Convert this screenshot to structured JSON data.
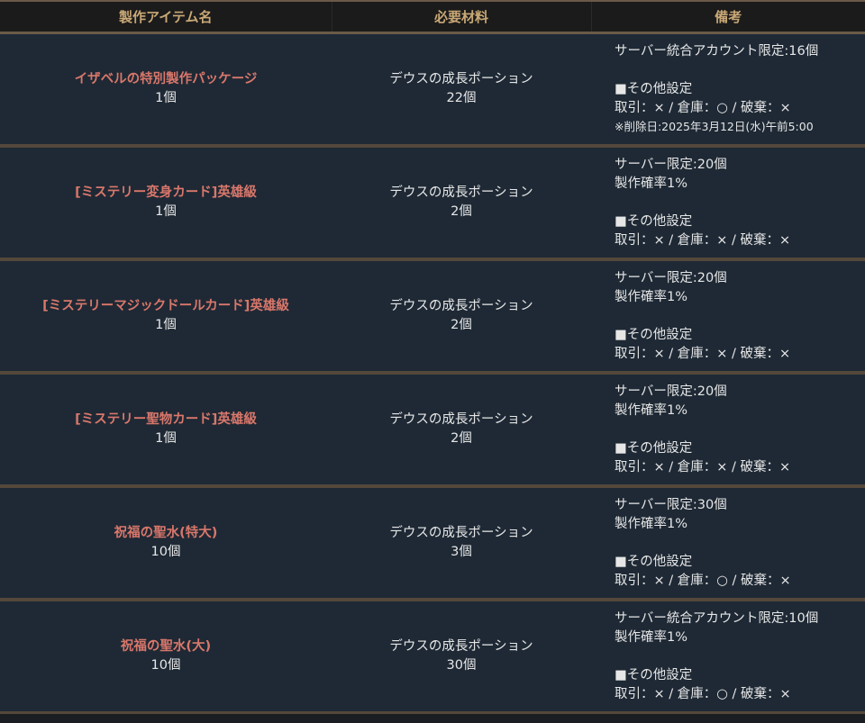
{
  "headers": {
    "item": "製作アイテム名",
    "materials": "必要材料",
    "notes": "備考"
  },
  "rows": [
    {
      "item_name": "イザベルの特別製作パッケージ",
      "item_qty": "1個",
      "material_name": "デウスの成長ポーション",
      "material_qty": "22個",
      "notes": [
        "サーバー統合アカウント限定:16個",
        "",
        "■その他設定",
        "取引：× / 倉庫：○ / 破棄：×"
      ],
      "small_note": "※削除日:2025年3月12日(水)午前5:00"
    },
    {
      "item_name": "[ミステリー変身カード]英雄級",
      "item_qty": "1個",
      "material_name": "デウスの成長ポーション",
      "material_qty": "2個",
      "notes": [
        "サーバー限定:20個",
        "製作確率1%",
        "",
        "■その他設定",
        "取引：× / 倉庫：× / 破棄：×"
      ],
      "small_note": ""
    },
    {
      "item_name": "[ミステリーマジックドールカード]英雄級",
      "item_qty": "1個",
      "material_name": "デウスの成長ポーション",
      "material_qty": "2個",
      "notes": [
        "サーバー限定:20個",
        "製作確率1%",
        "",
        "■その他設定",
        "取引：× / 倉庫：× / 破棄：×"
      ],
      "small_note": ""
    },
    {
      "item_name": "[ミステリー聖物カード]英雄級",
      "item_qty": "1個",
      "material_name": "デウスの成長ポーション",
      "material_qty": "2個",
      "notes": [
        "サーバー限定:20個",
        "製作確率1%",
        "",
        "■その他設定",
        "取引：× / 倉庫：× / 破棄：×"
      ],
      "small_note": ""
    },
    {
      "item_name": "祝福の聖水(特大)",
      "item_qty": "10個",
      "material_name": "デウスの成長ポーション",
      "material_qty": "3個",
      "notes": [
        "サーバー限定:30個",
        "製作確率1%",
        "",
        "■その他設定",
        "取引：× / 倉庫：○ / 破棄：×"
      ],
      "small_note": ""
    },
    {
      "item_name": "祝福の聖水(大)",
      "item_qty": "10個",
      "material_name": "デウスの成長ポーション",
      "material_qty": "30個",
      "notes": [
        "サーバー統合アカウント限定:10個",
        "製作確率1%",
        "",
        "■その他設定",
        "取引：× / 倉庫：○ / 破棄：×"
      ],
      "small_note": ""
    }
  ]
}
